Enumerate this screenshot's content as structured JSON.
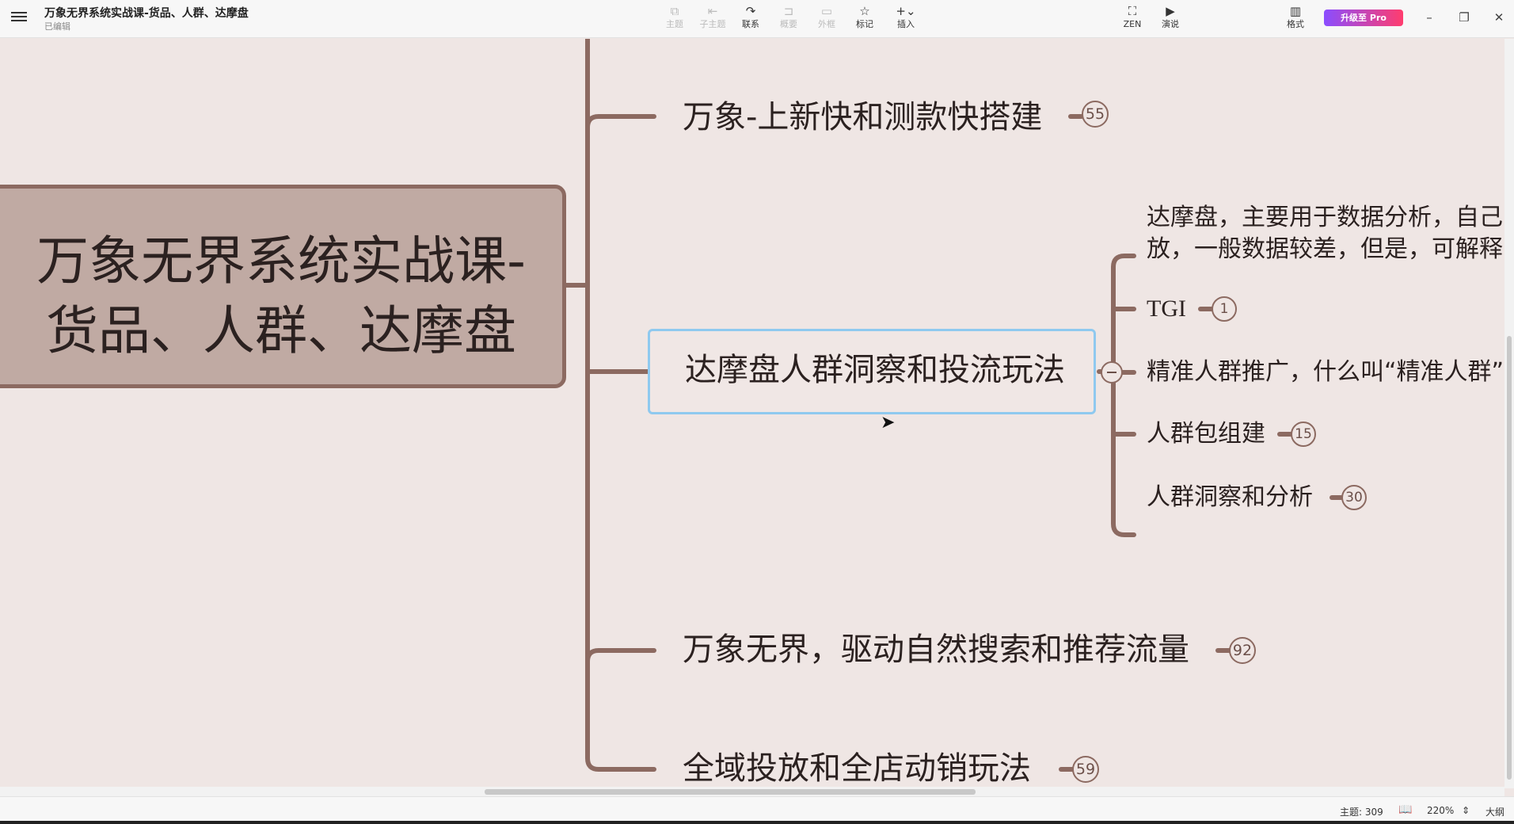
{
  "app": {
    "doc_title": "万象无界系统实战课-货品、人群、达摩盘",
    "doc_status": "已编辑"
  },
  "toolbar": {
    "items": [
      {
        "label": "主题",
        "icon": "topic-icon",
        "glyph": "⧉",
        "enabled": false
      },
      {
        "label": "子主题",
        "icon": "subtopic-icon",
        "glyph": "⇤",
        "enabled": false
      },
      {
        "label": "联系",
        "icon": "relationship-icon",
        "glyph": "↷",
        "enabled": true
      },
      {
        "label": "概要",
        "icon": "summary-icon",
        "glyph": "⊐",
        "enabled": false
      },
      {
        "label": "外框",
        "icon": "boundary-icon",
        "glyph": "▭",
        "enabled": false
      },
      {
        "label": "标记",
        "icon": "star-icon",
        "glyph": "☆",
        "enabled": true
      },
      {
        "label": "插入",
        "icon": "plus-icon",
        "glyph": "+⌄",
        "enabled": true
      }
    ],
    "zen": {
      "label": "ZEN",
      "icon": "fullscreen-icon",
      "glyph": "⛶"
    },
    "present": {
      "label": "演说",
      "icon": "play-icon",
      "glyph": "▶"
    },
    "format": {
      "label": "格式",
      "icon": "sidebar-icon",
      "glyph": "▥"
    },
    "upgrade_label": "升级至 Pro",
    "window": {
      "minimize": "–",
      "restore": "❐",
      "close": "✕"
    }
  },
  "mindmap": {
    "root": "万象无界系统实战课-货品、人群、达摩盘",
    "topics": [
      {
        "text": "万象-上新快和测款快搭建",
        "count": "55"
      },
      {
        "text": "达摩盘人群洞察和投流玩法",
        "selected": true
      },
      {
        "text": "万象无界，驱动自然搜索和推荐流量",
        "count": "92"
      },
      {
        "text": "全域投放和全店动销玩法",
        "count": "59"
      }
    ],
    "subtopics": [
      {
        "line1": "达摩盘，主要用于数据分析，自己",
        "line2": "放，一般数据较差，但是，可解释"
      },
      {
        "text": "TGI",
        "count": "1"
      },
      {
        "text": "精准人群推广，什么叫“精准人群”"
      },
      {
        "text": "人群包组建",
        "count": "15"
      },
      {
        "text": "人群洞察和分析",
        "count": "30"
      }
    ]
  },
  "statusbar": {
    "topic_count": "主题: 309",
    "zoom": "220%",
    "outline_label": "大纲",
    "book_icon": "book-icon"
  },
  "colors": {
    "canvas_bg": "#efe6e4",
    "branch": "#8c6a61",
    "root_fill": "#c0aaa3",
    "selection": "#8fc9ef"
  }
}
